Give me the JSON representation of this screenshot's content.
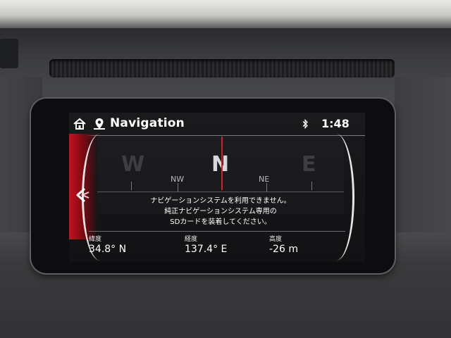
{
  "header": {
    "title": "Navigation",
    "time": "1:48",
    "icons": [
      "home-icon",
      "navigation-icon",
      "bluetooth-icon"
    ]
  },
  "compass": {
    "cardinals": [
      "W",
      "N",
      "E"
    ],
    "intercardinals": [
      "NW",
      "NE"
    ],
    "heading_marker_color": "#c8232f"
  },
  "message": {
    "lines": [
      "ナビゲーションシステムを利用できません。",
      "純正ナビゲーションシステム専用の",
      "SDカードを装着してください。"
    ]
  },
  "info": {
    "latitude": {
      "label": "緯度",
      "value": "34.8° N"
    },
    "longitude": {
      "label": "経度",
      "value": "137.4° E"
    },
    "altitude": {
      "label": "高度",
      "value": "-26 m"
    }
  },
  "colors": {
    "accent_red": "#c4121e",
    "text": "#ffffff",
    "screen_bg": "#121214"
  }
}
